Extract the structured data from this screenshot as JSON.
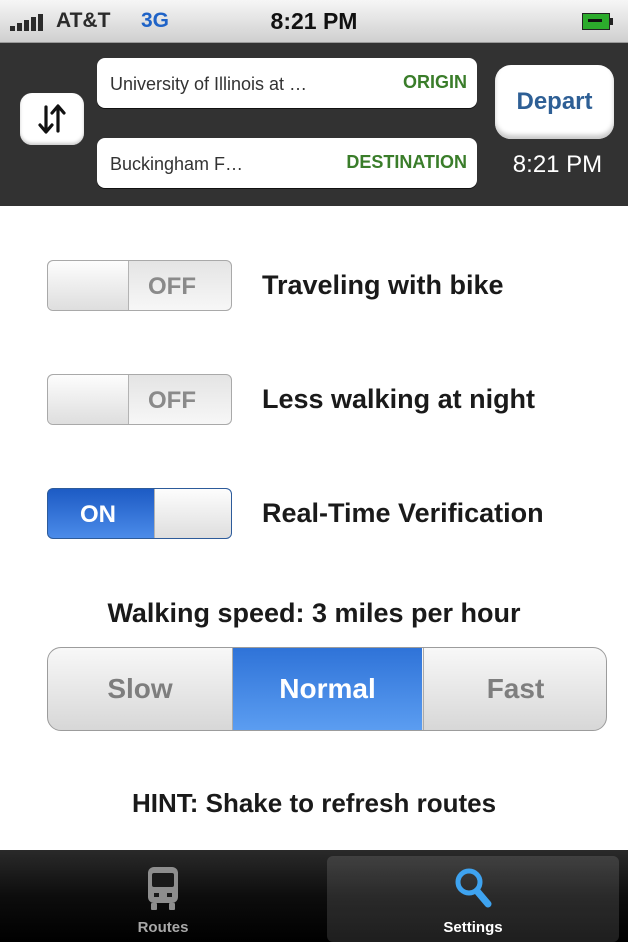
{
  "status_bar": {
    "carrier": "AT&T",
    "network": "3G",
    "time": "8:21 PM",
    "signal_icon": "signal-bars-icon",
    "battery_icon": "battery-charging-icon"
  },
  "header": {
    "swap_icon": "swap-arrows-icon",
    "origin": {
      "value": "University of Illinois at …",
      "tag": "ORIGIN"
    },
    "destination": {
      "value": "Buckingham F…",
      "tag": "DESTINATION"
    },
    "depart_label": "Depart",
    "depart_time": "8:21 PM"
  },
  "options": [
    {
      "label": "Traveling with bike",
      "state": "OFF",
      "on": false
    },
    {
      "label": "Less walking at night",
      "state": "OFF",
      "on": false
    },
    {
      "label": "Real-Time Verification",
      "state": "ON",
      "on": true
    }
  ],
  "walking_speed": {
    "title": "Walking speed: 3 miles per hour",
    "segments": [
      "Slow",
      "Normal",
      "Fast"
    ],
    "selected": "Normal"
  },
  "hint": "HINT: Shake to refresh routes",
  "tabbar": {
    "tabs": [
      {
        "label": "Routes",
        "icon": "bus-icon",
        "selected": false
      },
      {
        "label": "Settings",
        "icon": "magnifier-icon",
        "selected": true
      }
    ]
  },
  "colors": {
    "accent_blue": "#2f73d8",
    "header_bg": "#323232",
    "tag_green": "#3a7d2a",
    "depart_text": "#2e5f95"
  }
}
